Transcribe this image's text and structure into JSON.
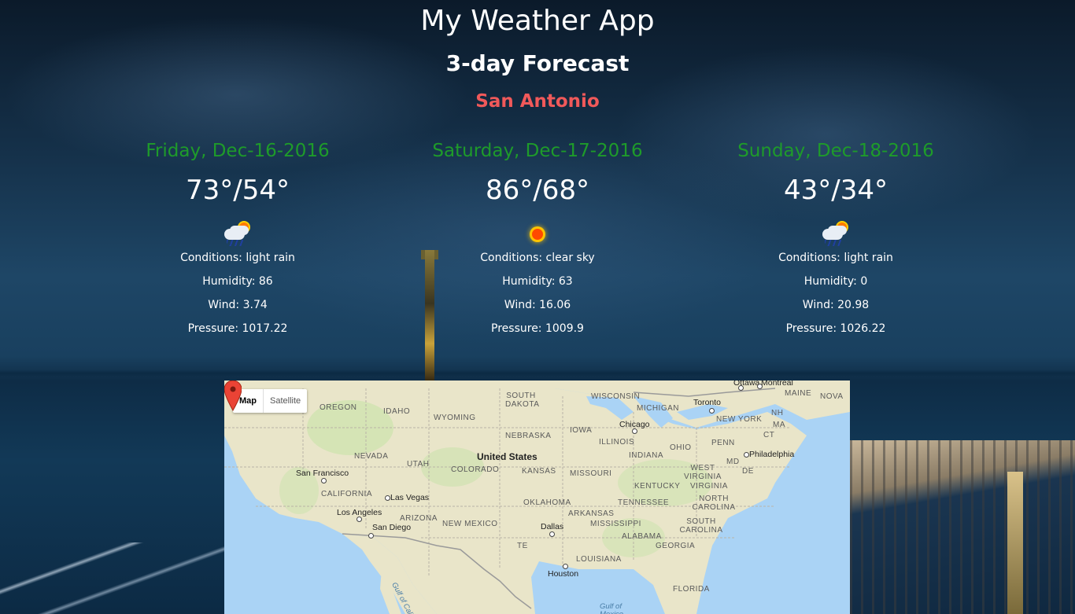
{
  "header": {
    "title": "My Weather App",
    "subtitle": "3-day Forecast",
    "city": "San Antonio"
  },
  "forecast": [
    {
      "date": "Friday, Dec-16-2016",
      "temp": "73°/54°",
      "icon": "rain-sun-icon",
      "conditions": "Conditions: light rain",
      "humidity": "Humidity: 86",
      "wind": "Wind: 3.74",
      "pressure": "Pressure: 1017.22"
    },
    {
      "date": "Saturday, Dec-17-2016",
      "temp": "86°/68°",
      "icon": "sun-icon",
      "conditions": "Conditions: clear sky",
      "humidity": "Humidity: 63",
      "wind": "Wind: 16.06",
      "pressure": "Pressure: 1009.9"
    },
    {
      "date": "Sunday, Dec-18-2016",
      "temp": "43°/34°",
      "icon": "rain-sun-icon",
      "conditions": "Conditions: light rain",
      "humidity": "Humidity: 0",
      "wind": "Wind: 20.98",
      "pressure": "Pressure: 1026.22"
    }
  ],
  "map": {
    "toggle_map": "Map",
    "toggle_satellite": "Satellite",
    "country": "United States",
    "states": [
      "OREGON",
      "IDAHO",
      "WYOMING",
      "SOUTH DAKOTA",
      "WISCONSIN",
      "MICHIGAN",
      "IOWA",
      "NEBRASKA",
      "NEVADA",
      "UTAH",
      "COLORADO",
      "KANSAS",
      "MISSOURI",
      "ILLINOIS",
      "INDIANA",
      "OHIO",
      "PENN",
      "CALIFORNIA",
      "ARIZONA",
      "NEW MEXICO",
      "OKLAHOMA",
      "ARKANSAS",
      "TENNESSEE",
      "KENTUCKY",
      "WEST VIRGINIA",
      "VIRGINIA",
      "NORTH CAROLINA",
      "SOUTH CAROLINA",
      "MISSISSIPPI",
      "ALABAMA",
      "GEORGIA",
      "LOUISIANA",
      "FLORIDA",
      "NEW YORK",
      "MAINE",
      "NOVA",
      "NH",
      "MA",
      "CT",
      "MD",
      "DE",
      "TE"
    ],
    "cities": [
      "Ottawa",
      "Montreal",
      "Toronto",
      "Chicago",
      "San Francisco",
      "Las Vegas",
      "Los Angeles",
      "San Diego",
      "Dallas",
      "Houston",
      "Philadelphia"
    ],
    "water": [
      "Gulf of California",
      "Gulf of Mexico"
    ],
    "colors": {
      "water": "#aad3f5",
      "land": "#e9e5c9",
      "park": "#cfe3b0",
      "pin": "#ea4335"
    }
  },
  "colors": {
    "date": "#1e9b2a",
    "city": "#f0595a",
    "text": "#ffffff"
  }
}
